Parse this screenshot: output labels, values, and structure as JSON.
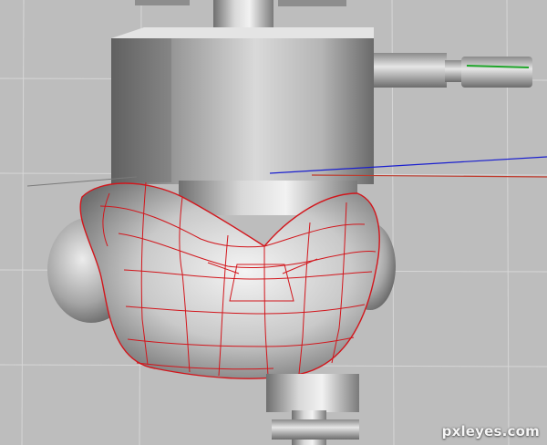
{
  "viewport": {
    "background_color": "#bdbdbd",
    "grid_color": "#d6d6d6",
    "axes": {
      "x_axis_color": "#c0392b",
      "y_axis_color": "#1fa62a",
      "z_axis_color": "#1a1fcf"
    },
    "wireframe_color": "#d2161c",
    "selected_object": "torso-mesh"
  },
  "watermark": {
    "text": "pxleyes.com"
  }
}
